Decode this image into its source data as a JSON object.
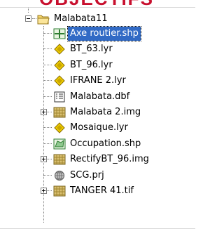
{
  "banner": {
    "text": "OBJECTIFS"
  },
  "tree": {
    "root": {
      "label": "Malabata11",
      "icon": "folder-open-icon",
      "expanded": true
    },
    "items": [
      {
        "label": "Axe routier.shp",
        "icon": "shapefile-line-icon",
        "selected": true,
        "expander": ""
      },
      {
        "label": "BT_63.lyr",
        "icon": "layer-file-icon",
        "expander": ""
      },
      {
        "label": "BT_96.lyr",
        "icon": "layer-file-icon",
        "expander": ""
      },
      {
        "label": "IFRANE 2.lyr",
        "icon": "layer-file-icon",
        "expander": ""
      },
      {
        "label": "Malabata.dbf",
        "icon": "table-file-icon",
        "expander": ""
      },
      {
        "label": "Malabata 2.img",
        "icon": "raster-image-icon",
        "expander": "plus"
      },
      {
        "label": "Mosaique.lyr",
        "icon": "layer-file-icon",
        "expander": ""
      },
      {
        "label": "Occupation.shp",
        "icon": "shapefile-polygon-icon",
        "expander": ""
      },
      {
        "label": "RectifyBT_96.img",
        "icon": "raster-image-icon",
        "expander": "plus"
      },
      {
        "label": "SCG.prj",
        "icon": "projection-globe-icon",
        "expander": ""
      },
      {
        "label": "TANGER 41.tif",
        "icon": "raster-image-icon",
        "expander": "plus"
      }
    ]
  },
  "colors": {
    "selection": "#316ac5",
    "banner": "#c8102e",
    "folder": "#f3d46b",
    "layer": "#e6c200",
    "raster": "#b89a3a"
  }
}
